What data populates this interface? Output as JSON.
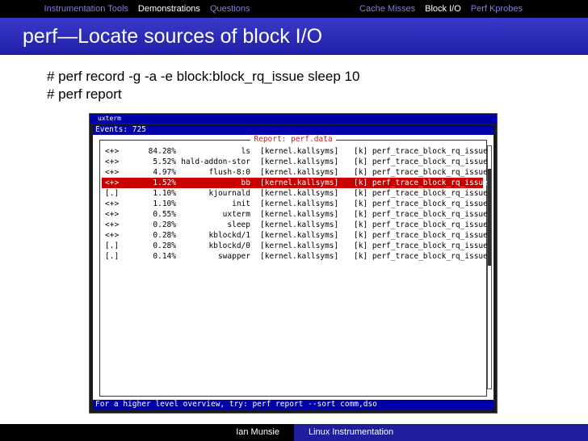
{
  "nav": {
    "sections": [
      "Instrumentation Tools",
      "Demonstrations",
      "Questions"
    ],
    "active_section": 1,
    "subsections": [
      "Cache Misses",
      "Block I/O",
      "Perf Kprobes"
    ],
    "active_subsection": 1
  },
  "slide": {
    "title": "perf—Locate sources of block I/O",
    "lines": [
      "# perf record -g -a -e block:block_rq_issue sleep 10",
      "# perf report"
    ]
  },
  "xterm": {
    "window_title": "uxterm",
    "events": "Events: 725",
    "report_title": "Report: perf.data",
    "selected_row": 3,
    "rows": [
      {
        "prefix": "<+>",
        "percent": "84.28%",
        "command": "ls",
        "dso": "[kernel.kallsyms]",
        "symbol": "[k] perf_trace_block_rq_issue"
      },
      {
        "prefix": "<+>",
        "percent": "5.52%",
        "command": "hald-addon-stor",
        "dso": "[kernel.kallsyms]",
        "symbol": "[k] perf_trace_block_rq_issue"
      },
      {
        "prefix": "<+>",
        "percent": "4.97%",
        "command": "flush-8:0",
        "dso": "[kernel.kallsyms]",
        "symbol": "[k] perf_trace_block_rq_issue"
      },
      {
        "prefix": "<+>",
        "percent": "1.52%",
        "command": "bb",
        "dso": "[kernel.kallsyms]",
        "symbol": "[k] perf_trace_block_rq_issue"
      },
      {
        "prefix": "[.]",
        "percent": "1.10%",
        "command": "kjournald",
        "dso": "[kernel.kallsyms]",
        "symbol": "[k] perf_trace_block_rq_issue"
      },
      {
        "prefix": "<+>",
        "percent": "1.10%",
        "command": "init",
        "dso": "[kernel.kallsyms]",
        "symbol": "[k] perf_trace_block_rq_issue"
      },
      {
        "prefix": "<+>",
        "percent": "0.55%",
        "command": "uxterm",
        "dso": "[kernel.kallsyms]",
        "symbol": "[k] perf_trace_block_rq_issue"
      },
      {
        "prefix": "<+>",
        "percent": "0.28%",
        "command": "sleep",
        "dso": "[kernel.kallsyms]",
        "symbol": "[k] perf_trace_block_rq_issue"
      },
      {
        "prefix": "<+>",
        "percent": "0.28%",
        "command": "kblockd/1",
        "dso": "[kernel.kallsyms]",
        "symbol": "[k] perf_trace_block_rq_issue"
      },
      {
        "prefix": "[.]",
        "percent": "0.28%",
        "command": "kblockd/0",
        "dso": "[kernel.kallsyms]",
        "symbol": "[k] perf_trace_block_rq_issue"
      },
      {
        "prefix": "[.]",
        "percent": "0.14%",
        "command": "swapper",
        "dso": "[kernel.kallsyms]",
        "symbol": "[k] perf_trace_block_rq_issue"
      }
    ],
    "hint": "For a higher level overview, try: perf report --sort comm,dso"
  },
  "footer": {
    "author": "Ian Munsie",
    "talk_title": "Linux Instrumentation"
  },
  "colors": {
    "accent": "#1f1fa8",
    "selection": "#c80000",
    "nav_inactive": "#7f7fd6"
  }
}
